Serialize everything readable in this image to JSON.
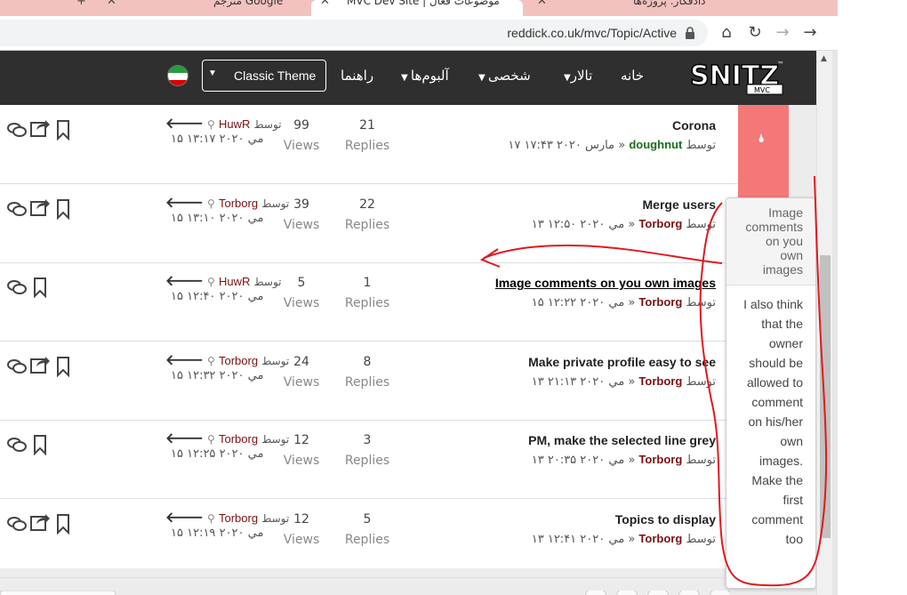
{
  "browser": {
    "tabs": [
      {
        "label": "دادفکار: پروژه‌ها"
      },
      {
        "label": "MVC Dev Site | موضوعات فعال"
      },
      {
        "label": "مترجم Google"
      }
    ],
    "url": "reddick.co.uk/mvc/Topic/Active"
  },
  "nav": {
    "home": "خانه",
    "forum": "تالار",
    "personal": "شخصی",
    "albums": "آلبوم‌ها",
    "help": "راهنما",
    "theme": "Classic Theme",
    "logo_text": "SNITZ",
    "logo_sub": "MVC",
    "logo_tm": "™"
  },
  "labels": {
    "by": "توسط",
    "views": "Views",
    "replies": "Replies",
    "sep": "»"
  },
  "topics": [
    {
      "title": "Corona",
      "author": "doughnut",
      "date": "۱۷ مارس ۲۰۲۰ ۱۷:۴۳",
      "replies": "21",
      "views": "99",
      "last_author": "HuwR",
      "last_date": "۱۵ مي ۲۰۲۰ ۱۳:۱۷"
    },
    {
      "title": "Merge users",
      "author": "Torborg",
      "date": "۱۳ مي ۲۰۲۰ ۱۲:۵۰",
      "replies": "22",
      "views": "39",
      "last_author": "Torborg",
      "last_date": "۱۵ مي ۲۰۲۰ ۱۳:۱۰"
    },
    {
      "title": "Image comments on you own images",
      "author": "Torborg",
      "date": "۱۵ مي ۲۰۲۰ ۱۲:۲۲",
      "replies": "1",
      "views": "5",
      "last_author": "HuwR",
      "last_date": "۱۵ مي ۲۰۲۰ ۱۲:۴۰"
    },
    {
      "title": "Make private profile easy to see",
      "author": "Torborg",
      "date": "۱۳ مي ۲۰۲۰ ۲۱:۱۳",
      "replies": "8",
      "views": "24",
      "last_author": "Torborg",
      "last_date": "۱۵ مي ۲۰۲۰ ۱۲:۳۲"
    },
    {
      "title": "PM, make the selected line grey",
      "author": "Torborg",
      "date": "۱۳ مي ۲۰۲۰ ۲۰:۳۵",
      "replies": "3",
      "views": "12",
      "last_author": "Torborg",
      "last_date": "۱۵ مي ۲۰۲۰ ۱۲:۲۵"
    },
    {
      "title": "Topics to display",
      "author": "Torborg",
      "date": "۱۳ مي ۲۰۲۰ ۱۲:۴۱",
      "replies": "5",
      "views": "12",
      "last_author": "Torborg",
      "last_date": "۱۵ مي ۲۰۲۰ ۱۲:۱۹"
    }
  ],
  "popover": {
    "title": [
      "Image",
      "comments",
      "on you",
      "own",
      "images"
    ],
    "body": [
      "I also think",
      "that the",
      "owner",
      "should be",
      "allowed to",
      "comment",
      "on his/her",
      "own",
      "images.",
      "Make the",
      "first",
      "comment",
      "too"
    ]
  },
  "colors": {
    "nav_bg": "#2f2f2f",
    "author": "#7a1010",
    "author_green": "#1a6e1a",
    "ribbon": "#f47878",
    "annotation": "#e0191f"
  }
}
